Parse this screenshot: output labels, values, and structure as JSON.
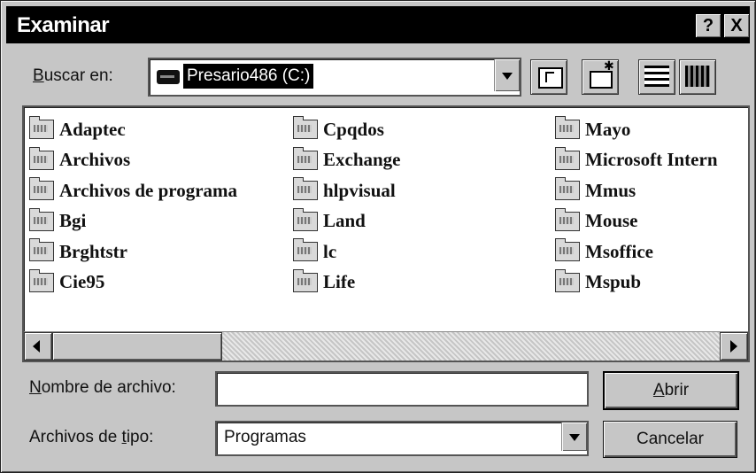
{
  "title": "Examinar",
  "title_buttons": {
    "help": "?",
    "close": "X"
  },
  "look_in": {
    "label_u": "B",
    "label_rest": "uscar en:",
    "value": "Presario486 (C:)"
  },
  "toolbar": {
    "icons": [
      "up-one-level-icon",
      "new-folder-icon",
      "list-view-icon",
      "details-view-icon"
    ]
  },
  "files": {
    "columns": [
      [
        "Adaptec",
        "Archivos",
        "Archivos de programa",
        "Bgi",
        "Brghtstr",
        "Cie95"
      ],
      [
        "Cpqdos",
        "Exchange",
        "hlpvisual",
        "Land",
        "lc",
        "Life"
      ],
      [
        "Mayo",
        "Microsoft Intern",
        "Mmus",
        "Mouse",
        "Msoffice",
        "Mspub"
      ]
    ]
  },
  "filename": {
    "label_u": "N",
    "label_rest": "ombre de archivo:",
    "value": ""
  },
  "filetype": {
    "label_pre": "Archivos de ",
    "label_u": "t",
    "label_rest": "ipo:",
    "value": "Programas"
  },
  "buttons": {
    "open_u": "A",
    "open_rest": "brir",
    "cancel": "Cancelar"
  }
}
